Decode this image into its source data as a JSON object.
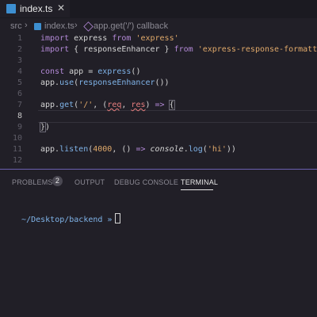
{
  "tab": {
    "filename": "index.ts",
    "close_icon": "close-icon",
    "file_icon": "typescript-icon"
  },
  "breadcrumb": {
    "folder": "src",
    "file": "index.ts",
    "symbol": "app.get('/') callback",
    "separator": "›"
  },
  "editor": {
    "active_line": 8,
    "lines": [
      {
        "n": "1",
        "tokens": [
          [
            "kw",
            "import"
          ],
          [
            "pl",
            " express "
          ],
          [
            "kw",
            "from"
          ],
          [
            "pl",
            " "
          ],
          [
            "str",
            "'express'"
          ]
        ]
      },
      {
        "n": "2",
        "tokens": [
          [
            "kw",
            "import"
          ],
          [
            "pl",
            " { responseEnhancer } "
          ],
          [
            "kw",
            "from"
          ],
          [
            "pl",
            " "
          ],
          [
            "str",
            "'express-response-formatter'"
          ]
        ]
      },
      {
        "n": "3",
        "tokens": []
      },
      {
        "n": "4",
        "tokens": [
          [
            "kw",
            "const"
          ],
          [
            "pl",
            " app = "
          ],
          [
            "fn",
            "express"
          ],
          [
            "pl",
            "()"
          ]
        ]
      },
      {
        "n": "5",
        "tokens": [
          [
            "pl",
            "app."
          ],
          [
            "fn",
            "use"
          ],
          [
            "pl",
            "("
          ],
          [
            "fn",
            "responseEnhancer"
          ],
          [
            "pl",
            "())"
          ]
        ]
      },
      {
        "n": "6",
        "tokens": []
      },
      {
        "n": "7",
        "tokens": [
          [
            "pl",
            "app."
          ],
          [
            "fn",
            "get"
          ],
          [
            "pl",
            "("
          ],
          [
            "str",
            "'/'"
          ],
          [
            "pl",
            ", ("
          ],
          [
            "param",
            "req"
          ],
          [
            "pl",
            ", "
          ],
          [
            "param",
            "res"
          ],
          [
            "pl",
            ") "
          ],
          [
            "kw",
            "=>"
          ],
          [
            "pl",
            " "
          ],
          [
            "bracket",
            "{"
          ]
        ]
      },
      {
        "n": "8",
        "tokens": []
      },
      {
        "n": "9",
        "tokens": [
          [
            "bracket",
            "}"
          ],
          [
            "pl",
            ")"
          ]
        ]
      },
      {
        "n": "10",
        "tokens": []
      },
      {
        "n": "11",
        "tokens": [
          [
            "pl",
            "app."
          ],
          [
            "fn",
            "listen"
          ],
          [
            "pl",
            "("
          ],
          [
            "num",
            "4000"
          ],
          [
            "pl",
            ", () "
          ],
          [
            "kw",
            "=>"
          ],
          [
            "pl",
            " "
          ],
          [
            "ital",
            "console"
          ],
          [
            "pl",
            "."
          ],
          [
            "fn",
            "log"
          ],
          [
            "pl",
            "("
          ],
          [
            "str",
            "'hi'"
          ],
          [
            "pl",
            "))"
          ]
        ]
      },
      {
        "n": "12",
        "tokens": []
      }
    ]
  },
  "panel": {
    "tabs": [
      {
        "label": "PROBLEMS",
        "badge": "2",
        "active": false
      },
      {
        "label": "OUTPUT",
        "active": false
      },
      {
        "label": "DEBUG CONSOLE",
        "active": false
      },
      {
        "label": "TERMINAL",
        "active": true
      }
    ]
  },
  "terminal": {
    "prompt": "~/Desktop/backend »"
  },
  "colors": {
    "background": "#211f27",
    "keyword": "#b48ad8",
    "function": "#7fb3e8",
    "string": "#e0a96a",
    "error": "#e87f7f",
    "accent": "#6b5fb0"
  }
}
